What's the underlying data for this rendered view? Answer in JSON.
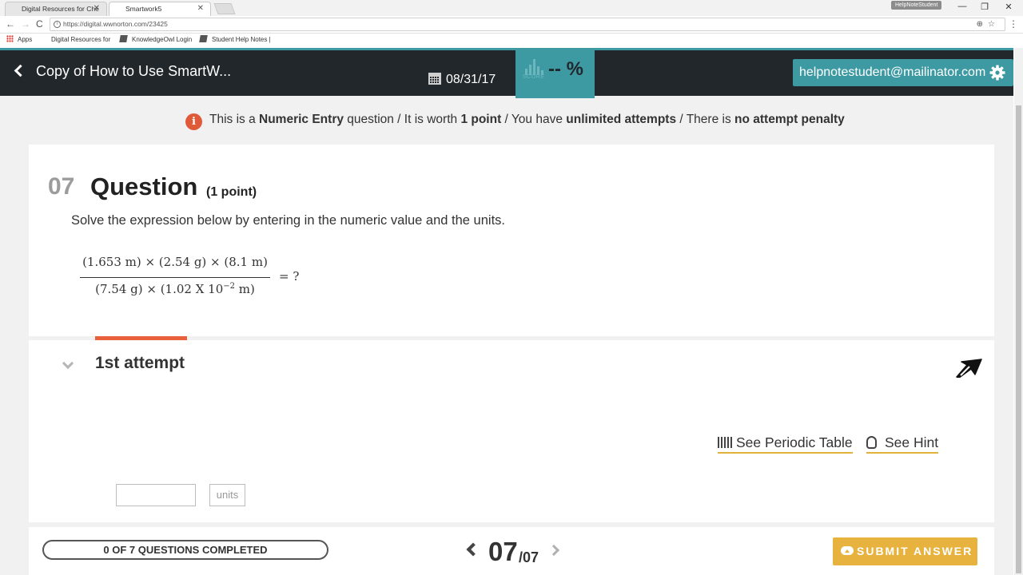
{
  "browser": {
    "tabs": [
      {
        "label": "Digital Resources for Che",
        "close": "✕"
      },
      {
        "label": "Smartwork5",
        "close": "✕"
      }
    ],
    "profile_chip": "HelpNoteStudent",
    "window_controls": {
      "minimize": "—",
      "restore": "❐",
      "close": "✕"
    },
    "url": "https://digital.wwnorton.com/23425",
    "nav": {
      "back": "←",
      "forward": "→",
      "reload": "C"
    },
    "bookmarks": [
      "Apps",
      "Digital Resources for",
      "KnowledgeOwl Login",
      "Student Help Notes |"
    ]
  },
  "header": {
    "back_title": "Copy of How to Use SmartW...",
    "due_date": "08/31/17",
    "score_label": "SCORE",
    "score_value": "-- %",
    "user_email": "helpnotestudent@mailinator.com",
    "accent_color": "#3d9aa3"
  },
  "info_banner": {
    "p1": "This is a ",
    "b1": "Numeric Entry",
    "p2": " question / It is worth ",
    "b2": "1 point",
    "p3": " / You have ",
    "b3": "unlimited attempts",
    "p4": " / There is ",
    "b4": "no attempt penalty",
    "icon": "i"
  },
  "question": {
    "number": "07",
    "title": "Question",
    "points": "(1 point)",
    "prompt": "Solve the expression below by entering in the numeric value and the units.",
    "equation": {
      "numerator": "(1.653 m)  ×  (2.54 g)  ×  (8.1 m)",
      "denominator_a": "(7.54 g)  ×  (1.02 X 10",
      "exponent": "−2",
      "denominator_b": " m)",
      "equals": "=  ?"
    }
  },
  "attempt": {
    "title": "1st attempt",
    "periodic_table_link": "See Periodic Table",
    "hint_link": "See Hint",
    "units_placeholder": "units"
  },
  "footer": {
    "progress": "0 OF 7 QUESTIONS COMPLETED",
    "current": "07",
    "total": "/07",
    "submit_label": "SUBMIT ANSWER",
    "submit_color": "#e7b23e"
  }
}
